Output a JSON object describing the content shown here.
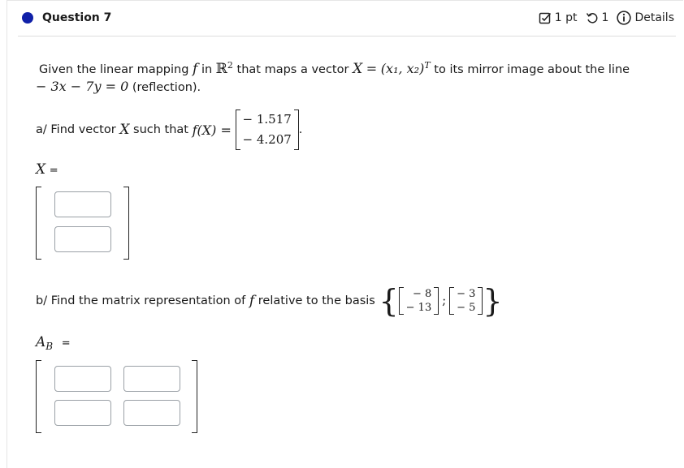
{
  "header": {
    "question_label": "Question 7",
    "points": "1 pt",
    "attempts": "1",
    "details_label": "Details"
  },
  "icons": {
    "status": "circle-filled",
    "points": "checkbox-icon",
    "attempts": "retry-icon",
    "details": "info-icon"
  },
  "colors": {
    "status_dot": "#1020a8"
  },
  "problem": {
    "intro_pre": "Given the linear mapping",
    "intro_f": "f",
    "intro_in": "in",
    "intro_R": "ℝ",
    "intro_R_exp": "2",
    "intro_maps": "that maps a vector",
    "intro_X": "X",
    "intro_eq": "=",
    "intro_vec": "(x₁, x₂)",
    "intro_T": "T",
    "intro_post": "to its mirror image about the line",
    "line_eq": "− 3x − 7y = 0",
    "reflection": "(reflection)."
  },
  "part_a": {
    "prompt": "a/ Find vector",
    "X": "X",
    "such_that": "such that",
    "fX": "f(X) =",
    "values": [
      "− 1.517",
      "− 4.207"
    ],
    "period": ".",
    "answer_label": "X",
    "answer_eq": "=",
    "inputs": [
      {
        "value": "",
        "placeholder": ""
      },
      {
        "value": "",
        "placeholder": ""
      }
    ]
  },
  "part_b": {
    "prompt": "b/ Find the matrix representation of",
    "f": "f",
    "relative": "relative to the basis",
    "basis": [
      [
        "− 8",
        "− 13"
      ],
      [
        "− 3",
        "− 5"
      ]
    ],
    "sep": ";",
    "open_brace": "{",
    "close_brace": "}",
    "answer_label": "A",
    "answer_sub": "B",
    "answer_eq": "=",
    "inputs": [
      {
        "value": "",
        "placeholder": ""
      },
      {
        "value": "",
        "placeholder": ""
      },
      {
        "value": "",
        "placeholder": ""
      },
      {
        "value": "",
        "placeholder": ""
      }
    ]
  }
}
